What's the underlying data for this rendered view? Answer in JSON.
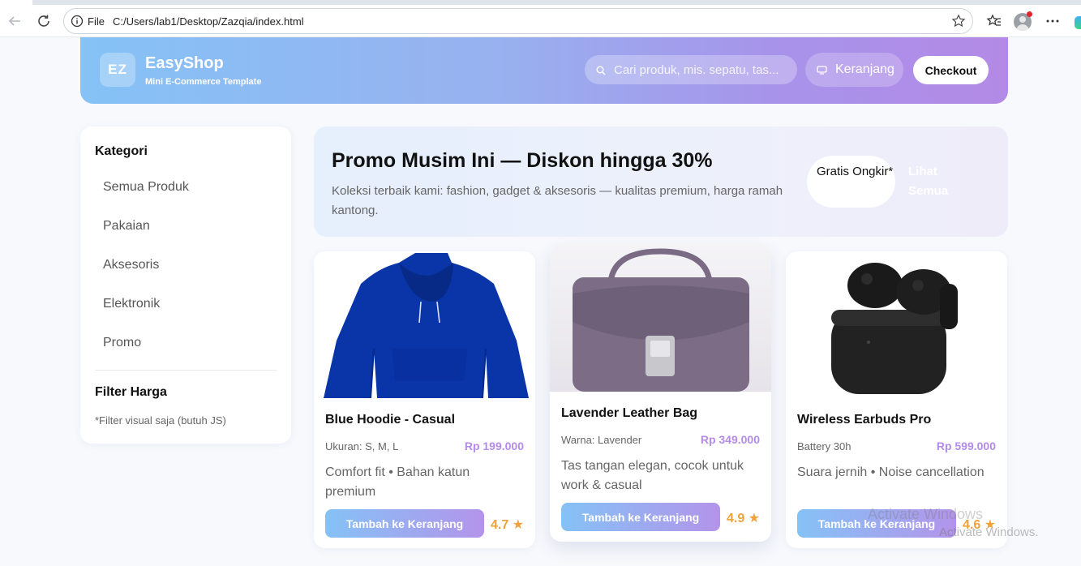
{
  "browser": {
    "file_label": "File",
    "url": "C:/Users/lab1/Desktop/Zazqia/index.html"
  },
  "header": {
    "logo": "EZ",
    "brand": "EasyShop",
    "tagline": "Mini E-Commerce Template",
    "search_placeholder": "Cari produk, mis. sepatu, tas...",
    "cart_label": "Keranjang",
    "checkout_label": "Checkout"
  },
  "sidebar": {
    "category_title": "Kategori",
    "categories": [
      "Semua Produk",
      "Pakaian",
      "Aksesoris",
      "Elektronik",
      "Promo"
    ],
    "filter_title": "Filter Harga",
    "filter_note": "*Filter visual saja (butuh JS)"
  },
  "promo": {
    "title": "Promo Musim Ini — Diskon hingga 30%",
    "description": "Koleksi terbaik kami: fashion, gadget & aksesoris — kualitas premium, harga ramah kantong.",
    "badge": "Gratis Ongkir*",
    "link": "Lihat Semua"
  },
  "products": [
    {
      "name": "Blue Hoodie - Casual",
      "meta": "Ukuran: S, M, L",
      "price": "Rp 199.000",
      "description": "Comfort fit • Bahan katun premium",
      "button": "Tambah ke Keranjang",
      "rating": "4.7 ★",
      "color": "#0a35a8"
    },
    {
      "name": "Lavender Leather Bag",
      "meta": "Warna: Lavender",
      "price": "Rp 349.000",
      "description": "Tas tangan elegan, cocok untuk work & casual",
      "button": "Tambah ke Keranjang",
      "rating": "4.9 ★",
      "color": "#7c6c86"
    },
    {
      "name": "Wireless Earbuds Pro",
      "meta": "Battery 30h",
      "price": "Rp 599.000",
      "description": "Suara jernih • Noise cancellation",
      "button": "Tambah ke Keranjang",
      "rating": "4.6 ★",
      "color": "#1e1e1e"
    }
  ],
  "watermark": {
    "line1": "Activate Windows",
    "line2": "Activate Windows."
  }
}
